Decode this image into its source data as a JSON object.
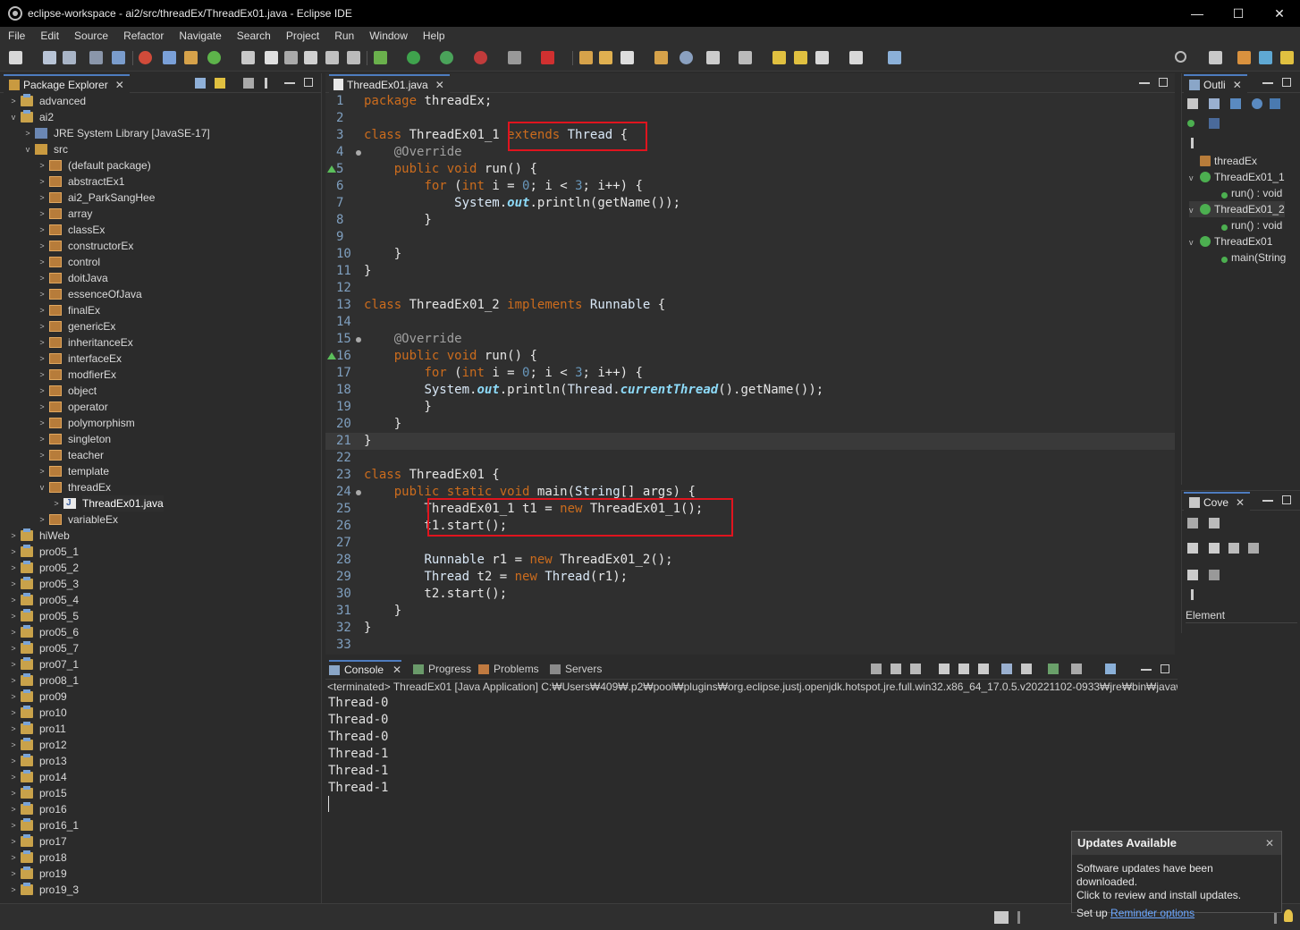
{
  "window": {
    "title": "eclipse-workspace - ai2/src/threadEx/ThreadEx01.java - Eclipse IDE",
    "minimize": "—",
    "maximize": "☐",
    "close": "✕"
  },
  "menu": [
    "File",
    "Edit",
    "Source",
    "Refactor",
    "Navigate",
    "Search",
    "Project",
    "Run",
    "Window",
    "Help"
  ],
  "package_explorer": {
    "tab_label": "Package Explorer",
    "close": "✕",
    "items": [
      {
        "label": "advanced",
        "depth": 0,
        "twisty": ">",
        "icon": "project"
      },
      {
        "label": "ai2",
        "depth": 0,
        "twisty": "v",
        "icon": "project"
      },
      {
        "label": "JRE System Library [JavaSE-17]",
        "depth": 1,
        "twisty": ">",
        "icon": "library"
      },
      {
        "label": "src",
        "depth": 1,
        "twisty": "v",
        "icon": "source-folder"
      },
      {
        "label": "(default package)",
        "depth": 2,
        "twisty": ">",
        "icon": "package"
      },
      {
        "label": "abstractEx1",
        "depth": 2,
        "twisty": ">",
        "icon": "package"
      },
      {
        "label": "ai2_ParkSangHee",
        "depth": 2,
        "twisty": ">",
        "icon": "package"
      },
      {
        "label": "array",
        "depth": 2,
        "twisty": ">",
        "icon": "package"
      },
      {
        "label": "classEx",
        "depth": 2,
        "twisty": ">",
        "icon": "package"
      },
      {
        "label": "constructorEx",
        "depth": 2,
        "twisty": ">",
        "icon": "package"
      },
      {
        "label": "control",
        "depth": 2,
        "twisty": ">",
        "icon": "package"
      },
      {
        "label": "doitJava",
        "depth": 2,
        "twisty": ">",
        "icon": "package"
      },
      {
        "label": "essenceOfJava",
        "depth": 2,
        "twisty": ">",
        "icon": "package"
      },
      {
        "label": "finalEx",
        "depth": 2,
        "twisty": ">",
        "icon": "package"
      },
      {
        "label": "genericEx",
        "depth": 2,
        "twisty": ">",
        "icon": "package"
      },
      {
        "label": "inheritanceEx",
        "depth": 2,
        "twisty": ">",
        "icon": "package"
      },
      {
        "label": "interfaceEx",
        "depth": 2,
        "twisty": ">",
        "icon": "package"
      },
      {
        "label": "modfierEx",
        "depth": 2,
        "twisty": ">",
        "icon": "package"
      },
      {
        "label": "object",
        "depth": 2,
        "twisty": ">",
        "icon": "package"
      },
      {
        "label": "operator",
        "depth": 2,
        "twisty": ">",
        "icon": "package"
      },
      {
        "label": "polymorphism",
        "depth": 2,
        "twisty": ">",
        "icon": "package"
      },
      {
        "label": "singleton",
        "depth": 2,
        "twisty": ">",
        "icon": "package"
      },
      {
        "label": "teacher",
        "depth": 2,
        "twisty": ">",
        "icon": "package"
      },
      {
        "label": "template",
        "depth": 2,
        "twisty": ">",
        "icon": "package"
      },
      {
        "label": "threadEx",
        "depth": 2,
        "twisty": "v",
        "icon": "package"
      },
      {
        "label": "ThreadEx01.java",
        "depth": 3,
        "twisty": ">",
        "icon": "java-file",
        "selected": true
      },
      {
        "label": "variableEx",
        "depth": 2,
        "twisty": ">",
        "icon": "package"
      },
      {
        "label": "hiWeb",
        "depth": 0,
        "twisty": ">",
        "icon": "project"
      },
      {
        "label": "pro05_1",
        "depth": 0,
        "twisty": ">",
        "icon": "project"
      },
      {
        "label": "pro05_2",
        "depth": 0,
        "twisty": ">",
        "icon": "project"
      },
      {
        "label": "pro05_3",
        "depth": 0,
        "twisty": ">",
        "icon": "project"
      },
      {
        "label": "pro05_4",
        "depth": 0,
        "twisty": ">",
        "icon": "project"
      },
      {
        "label": "pro05_5",
        "depth": 0,
        "twisty": ">",
        "icon": "project"
      },
      {
        "label": "pro05_6",
        "depth": 0,
        "twisty": ">",
        "icon": "project"
      },
      {
        "label": "pro05_7",
        "depth": 0,
        "twisty": ">",
        "icon": "project"
      },
      {
        "label": "pro07_1",
        "depth": 0,
        "twisty": ">",
        "icon": "project"
      },
      {
        "label": "pro08_1",
        "depth": 0,
        "twisty": ">",
        "icon": "project"
      },
      {
        "label": "pro09",
        "depth": 0,
        "twisty": ">",
        "icon": "project"
      },
      {
        "label": "pro10",
        "depth": 0,
        "twisty": ">",
        "icon": "project"
      },
      {
        "label": "pro11",
        "depth": 0,
        "twisty": ">",
        "icon": "project"
      },
      {
        "label": "pro12",
        "depth": 0,
        "twisty": ">",
        "icon": "project"
      },
      {
        "label": "pro13",
        "depth": 0,
        "twisty": ">",
        "icon": "project"
      },
      {
        "label": "pro14",
        "depth": 0,
        "twisty": ">",
        "icon": "project"
      },
      {
        "label": "pro15",
        "depth": 0,
        "twisty": ">",
        "icon": "project"
      },
      {
        "label": "pro16",
        "depth": 0,
        "twisty": ">",
        "icon": "project"
      },
      {
        "label": "pro16_1",
        "depth": 0,
        "twisty": ">",
        "icon": "project"
      },
      {
        "label": "pro17",
        "depth": 0,
        "twisty": ">",
        "icon": "project"
      },
      {
        "label": "pro18",
        "depth": 0,
        "twisty": ">",
        "icon": "project"
      },
      {
        "label": "pro19",
        "depth": 0,
        "twisty": ">",
        "icon": "project"
      },
      {
        "label": "pro19_3",
        "depth": 0,
        "twisty": ">",
        "icon": "project"
      }
    ]
  },
  "editor": {
    "tab_label": "ThreadEx01.java",
    "close": "✕",
    "lines": [
      [
        [
          "kw",
          "package"
        ],
        [
          "pl",
          " threadEx;"
        ]
      ],
      [],
      [
        [
          "kw",
          "class"
        ],
        [
          "pl",
          " ThreadEx01_1 "
        ],
        [
          "kw",
          "extends"
        ],
        [
          "pl",
          " "
        ],
        [
          "ty",
          "Thread"
        ],
        [
          "pl",
          " {"
        ]
      ],
      [
        [
          "pl",
          "    "
        ],
        [
          "an",
          "@Override"
        ]
      ],
      [
        [
          "pl",
          "    "
        ],
        [
          "kw",
          "public"
        ],
        [
          "pl",
          " "
        ],
        [
          "kw",
          "void"
        ],
        [
          "pl",
          " "
        ],
        [
          "pl",
          "run() {"
        ]
      ],
      [
        [
          "pl",
          "        "
        ],
        [
          "kw",
          "for"
        ],
        [
          "pl",
          " ("
        ],
        [
          "kw",
          "int"
        ],
        [
          "pl",
          " i = "
        ],
        [
          "num",
          "0"
        ],
        [
          "pl",
          "; i < "
        ],
        [
          "num",
          "3"
        ],
        [
          "pl",
          "; i++) {"
        ]
      ],
      [
        [
          "pl",
          "            "
        ],
        [
          "ty",
          "System"
        ],
        [
          "pl",
          "."
        ],
        [
          "fld",
          "out"
        ],
        [
          "pl",
          ".println(getName());"
        ]
      ],
      [
        [
          "pl",
          "        }"
        ]
      ],
      [],
      [
        [
          "pl",
          "    }"
        ]
      ],
      [
        [
          "pl",
          "}"
        ]
      ],
      [],
      [
        [
          "kw",
          "class"
        ],
        [
          "pl",
          " ThreadEx01_2 "
        ],
        [
          "kw",
          "implements"
        ],
        [
          "pl",
          " "
        ],
        [
          "ty",
          "Runnable"
        ],
        [
          "pl",
          " {"
        ]
      ],
      [],
      [
        [
          "pl",
          "    "
        ],
        [
          "an",
          "@Override"
        ]
      ],
      [
        [
          "pl",
          "    "
        ],
        [
          "kw",
          "public"
        ],
        [
          "pl",
          " "
        ],
        [
          "kw",
          "void"
        ],
        [
          "pl",
          " run() {"
        ]
      ],
      [
        [
          "pl",
          "        "
        ],
        [
          "kw",
          "for"
        ],
        [
          "pl",
          " ("
        ],
        [
          "kw",
          "int"
        ],
        [
          "pl",
          " i = "
        ],
        [
          "num",
          "0"
        ],
        [
          "pl",
          "; i < "
        ],
        [
          "num",
          "3"
        ],
        [
          "pl",
          "; i++) {"
        ]
      ],
      [
        [
          "pl",
          "        "
        ],
        [
          "ty",
          "System"
        ],
        [
          "pl",
          "."
        ],
        [
          "fld",
          "out"
        ],
        [
          "pl",
          ".println("
        ],
        [
          "ty",
          "Thread"
        ],
        [
          "pl",
          "."
        ],
        [
          "fld",
          "currentThread"
        ],
        [
          "pl",
          "().getName());"
        ]
      ],
      [
        [
          "pl",
          "        }"
        ]
      ],
      [
        [
          "pl",
          "    }"
        ]
      ],
      [
        [
          "pl",
          "}"
        ]
      ],
      [],
      [
        [
          "kw",
          "class"
        ],
        [
          "pl",
          " ThreadEx01 {"
        ]
      ],
      [
        [
          "pl",
          "    "
        ],
        [
          "kw",
          "public"
        ],
        [
          "pl",
          " "
        ],
        [
          "kw",
          "static"
        ],
        [
          "pl",
          " "
        ],
        [
          "kw",
          "void"
        ],
        [
          "pl",
          " main("
        ],
        [
          "ty",
          "String"
        ],
        [
          "pl",
          "[] args) {"
        ]
      ],
      [
        [
          "pl",
          "        ThreadEx01_1 t1 = "
        ],
        [
          "kw",
          "new"
        ],
        [
          "pl",
          " ThreadEx01_1();"
        ]
      ],
      [
        [
          "pl",
          "        t1.start();"
        ]
      ],
      [],
      [
        [
          "pl",
          "        "
        ],
        [
          "ty",
          "Runnable"
        ],
        [
          "pl",
          " r1 = "
        ],
        [
          "kw",
          "new"
        ],
        [
          "pl",
          " ThreadEx01_2();"
        ]
      ],
      [
        [
          "pl",
          "        "
        ],
        [
          "ty",
          "Thread"
        ],
        [
          "pl",
          " t2 = "
        ],
        [
          "kw",
          "new"
        ],
        [
          "pl",
          " "
        ],
        [
          "ty",
          "Thread"
        ],
        [
          "pl",
          "(r1);"
        ]
      ],
      [
        [
          "pl",
          "        t2.start();"
        ]
      ],
      [
        [
          "pl",
          "    }"
        ]
      ],
      [
        [
          "pl",
          "}"
        ]
      ],
      []
    ],
    "line_numbers": [
      "1",
      "2",
      "3",
      "4",
      "5",
      "6",
      "7",
      "8",
      "9",
      "10",
      "11",
      "12",
      "13",
      "14",
      "15",
      "16",
      "17",
      "18",
      "19",
      "20",
      "21",
      "22",
      "23",
      "24",
      "25",
      "26",
      "27",
      "28",
      "29",
      "30",
      "31",
      "32",
      "33"
    ]
  },
  "console": {
    "tabs": [
      "Console",
      "Progress",
      "Problems",
      "Servers"
    ],
    "close": "✕",
    "terminated": "<terminated> ThreadEx01 [Java Application] C:₩Users₩409₩.p2₩pool₩plugins₩org.eclipse.justj.openjdk.hotspot.jre.full.win32.x86_64_17.0.5.v20221102-0933₩jre₩bin₩javaw.e",
    "output": [
      "Thread-0",
      "Thread-0",
      "Thread-0",
      "Thread-1",
      "Thread-1",
      "Thread-1"
    ]
  },
  "outline": {
    "tab_label": "Outli",
    "close": "✕",
    "items": [
      {
        "label": "threadEx",
        "depth": 0,
        "icon": "package"
      },
      {
        "label": "ThreadEx01_1",
        "depth": 0,
        "icon": "class",
        "twisty": "v"
      },
      {
        "label": "run() : void",
        "depth": 1,
        "icon": "method"
      },
      {
        "label": "ThreadEx01_2",
        "depth": 0,
        "icon": "class",
        "twisty": "v",
        "selected": true
      },
      {
        "label": "run() : void",
        "depth": 1,
        "icon": "method"
      },
      {
        "label": "ThreadEx01",
        "depth": 0,
        "icon": "class",
        "twisty": "v"
      },
      {
        "label": "main(String",
        "depth": 1,
        "icon": "method"
      }
    ]
  },
  "coverage": {
    "tab_label": "Cove",
    "close": "✕",
    "column": "Element"
  },
  "notification": {
    "title": "Updates Available",
    "close": "✕",
    "line1": "Software updates have been downloaded.",
    "line2": "Click to review and install updates.",
    "setup_prefix": "Set up ",
    "reminder_link": "Reminder options"
  }
}
